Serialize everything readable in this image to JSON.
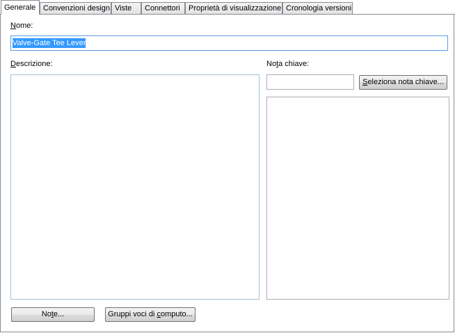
{
  "tabs": [
    {
      "label": "Generale",
      "active": true
    },
    {
      "label": "Convenzioni design",
      "active": false
    },
    {
      "label": "Viste",
      "active": false
    },
    {
      "label": "Connettori",
      "active": false
    },
    {
      "label": "Proprietà di visualizzazione",
      "active": false
    },
    {
      "label": "Cronologia versioni",
      "active": false
    }
  ],
  "general": {
    "name_label_accel": "N",
    "name_label_rest": "ome:",
    "name_value": "Valve-Gate Tee Lever",
    "description_label_accel": "D",
    "description_label_rest": "escrizione:",
    "description_value": "",
    "keynote_label_pre": "No",
    "keynote_label_accel": "t",
    "keynote_label_post": "a chiave:",
    "keynote_value": "",
    "keynote_list_items": [],
    "select_keynote_button_accel": "S",
    "select_keynote_button_rest": "eleziona nota chiave...",
    "notes_button_pre": "No",
    "notes_button_accel": "t",
    "notes_button_post": "e...",
    "cost_groups_button_pre": "Gruppi voci di ",
    "cost_groups_button_accel": "c",
    "cost_groups_button_post": "omputo..."
  },
  "colors": {
    "selection": "#3399ff",
    "focus_border": "#569de5",
    "tab_border": "#898c95"
  }
}
